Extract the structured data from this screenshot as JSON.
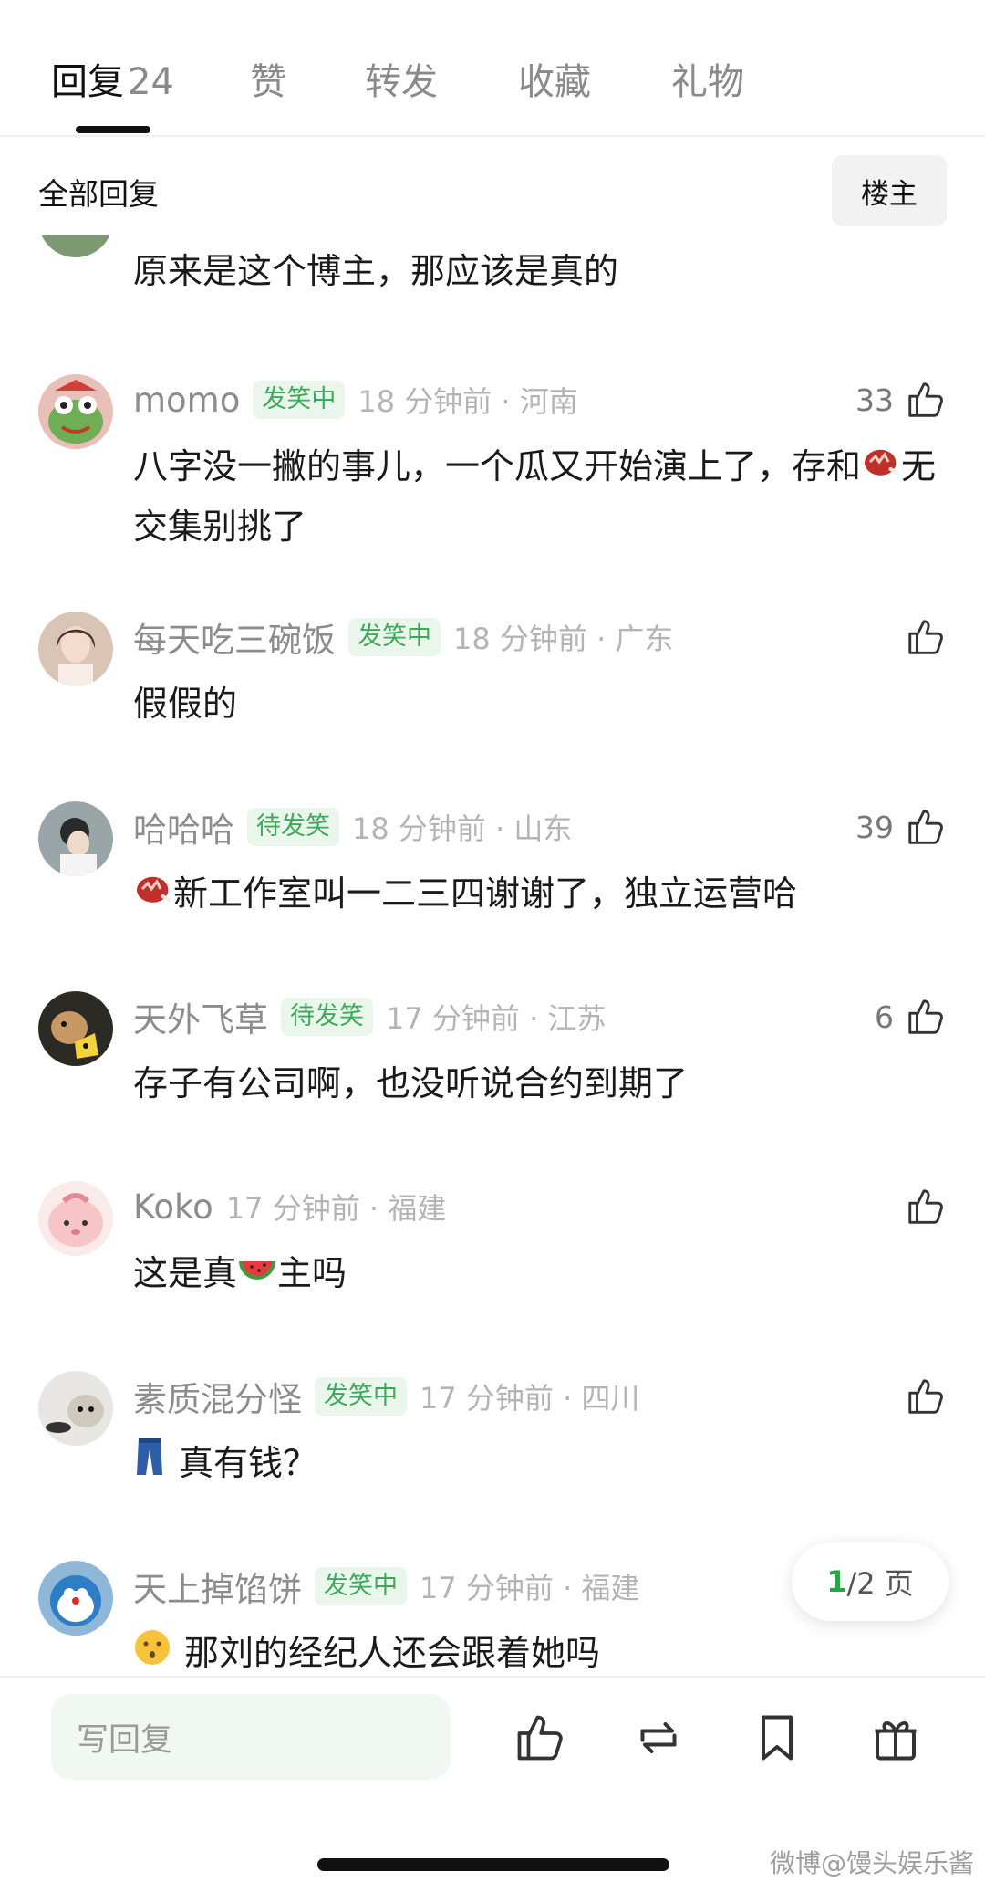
{
  "tabs": [
    {
      "label": "回复",
      "count": "24"
    },
    {
      "label": "赞"
    },
    {
      "label": "转发"
    },
    {
      "label": "收藏"
    },
    {
      "label": "礼物"
    }
  ],
  "section": {
    "title": "全部回复",
    "op_button": "楼主"
  },
  "partial_comment": {
    "text": "原来是这个博主，那应该是真的"
  },
  "comments": [
    {
      "username": "momo",
      "badge": "发笑中",
      "time": "18 分钟前 · 河南",
      "likes": "33",
      "text_a": "八字没一撇的事儿，一个瓜又开始演上了，存和",
      "emoji": "steak-icon",
      "text_b": "无交集别挑了"
    },
    {
      "username": "每天吃三碗饭",
      "badge": "发笑中",
      "time": "18 分钟前 · 广东",
      "likes": "",
      "text": "假假的"
    },
    {
      "username": "哈哈哈",
      "badge": "待发笑",
      "time": "18 分钟前 · 山东",
      "likes": "39",
      "emoji": "steak-icon",
      "text": "新工作室叫一二三四谢谢了，独立运营哈"
    },
    {
      "username": "天外飞草",
      "badge": "待发笑",
      "time": "17 分钟前 · 江苏",
      "likes": "6",
      "text": "存子有公司啊，也没听说合约到期了"
    },
    {
      "username": "Koko",
      "badge": "",
      "time": "17 分钟前 · 福建",
      "likes": "",
      "text_a": "这是真",
      "emoji": "watermelon-icon",
      "text_b": "主吗"
    },
    {
      "username": "素质混分怪",
      "badge": "发笑中",
      "time": "17 分钟前 · 四川",
      "likes": "",
      "emoji": "jeans-icon",
      "text": "真有钱？"
    },
    {
      "username": "天上掉馅饼",
      "badge": "发笑中",
      "time": "17 分钟前 · 福建",
      "likes": "",
      "emoji": "hushed-face-icon",
      "text": "那刘的经纪人还会跟着她吗"
    }
  ],
  "pagination": {
    "current": "1",
    "rest": "/2 页"
  },
  "bottom_bar": {
    "reply_placeholder": "写回复",
    "icons": [
      "like-icon",
      "repost-icon",
      "bookmark-icon",
      "gift-icon"
    ]
  },
  "watermark": "微博@馒头娱乐酱",
  "colors": {
    "accent_green": "#3fa95a",
    "badge_bg": "#eaf6ec",
    "reply_bg": "#f1f8f3"
  }
}
